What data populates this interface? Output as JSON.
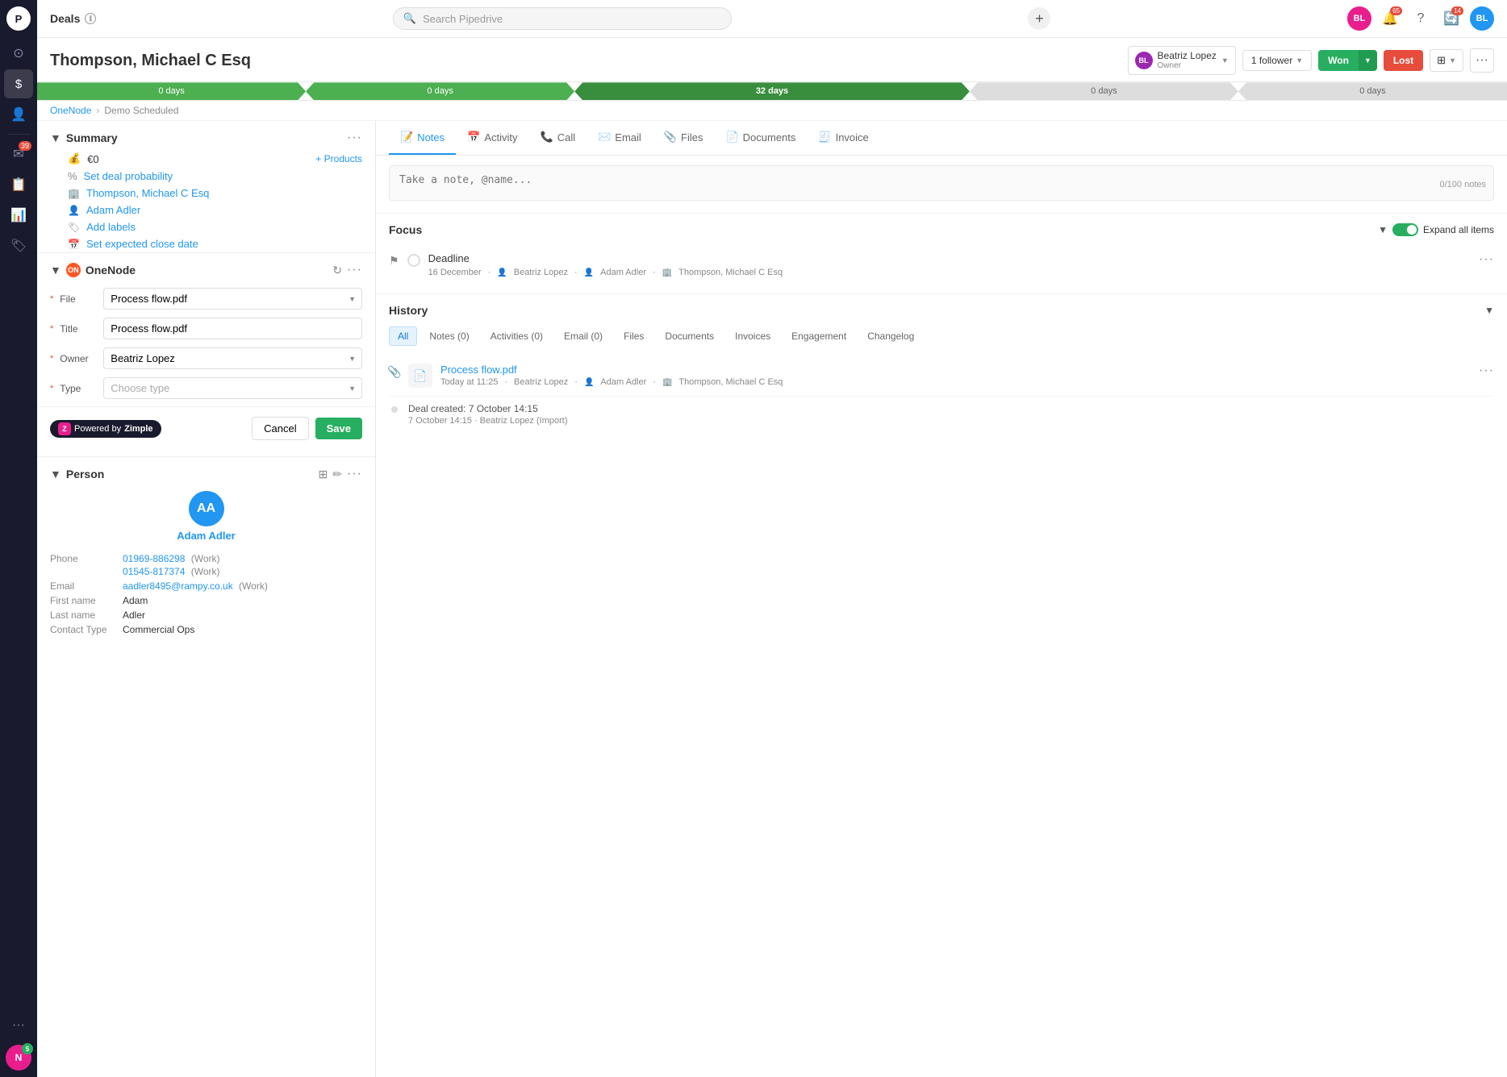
{
  "app": {
    "title": "Deals",
    "search_placeholder": "Search Pipedrive"
  },
  "deal": {
    "title": "Thompson, Michael C Esq",
    "owner": {
      "name": "Beatriz Lopez",
      "role": "Owner",
      "avatar_initials": "BL"
    },
    "follower_label": "1 follower",
    "won_label": "Won",
    "lost_label": "Lost",
    "pipeline": [
      {
        "label": "0 days",
        "active": true
      },
      {
        "label": "0 days",
        "active": true
      },
      {
        "label": "32 days",
        "active": true
      },
      {
        "label": "0 days",
        "active": false
      },
      {
        "label": "0 days",
        "active": false
      }
    ],
    "breadcrumb": {
      "org": "OneNode",
      "stage": "Demo Scheduled"
    }
  },
  "summary": {
    "section_title": "Summary",
    "amount": "€0",
    "add_products_label": "+ Products",
    "set_deal_probability": "Set deal probability",
    "contact": "Thompson, Michael C Esq",
    "person": "Adam Adler",
    "add_labels": "Add labels",
    "set_close_date": "Set expected close date"
  },
  "onenode": {
    "section_title": "OneNode",
    "file_label": "File",
    "file_value": "Process flow.pdf",
    "title_label": "Title",
    "title_value": "Process flow.pdf",
    "owner_label": "Owner",
    "owner_value": "Beatriz Lopez",
    "type_label": "Type",
    "type_placeholder": "Choose type",
    "cancel_label": "Cancel",
    "save_label": "Save",
    "powered_by": "Powered by",
    "zimple_label": "Zimple"
  },
  "person": {
    "section_title": "Person",
    "name": "Adam Adler",
    "avatar_initials": "AA",
    "phone1": "01969-886298",
    "phone1_type": "(Work)",
    "phone2": "01545-817374",
    "phone2_type": "(Work)",
    "email": "aadler8495@rampy.co.uk",
    "email_type": "(Work)",
    "first_name_label": "First name",
    "first_name": "Adam",
    "last_name_label": "Last name",
    "last_name": "Adler",
    "contact_type_label": "Contact Type",
    "contact_type": "Commercial Ops",
    "phone_label": "Phone",
    "email_label": "Email"
  },
  "tabs": [
    {
      "id": "notes",
      "label": "Notes",
      "icon": "📝",
      "active": true
    },
    {
      "id": "activity",
      "label": "Activity",
      "icon": "📅",
      "active": false
    },
    {
      "id": "call",
      "label": "Call",
      "icon": "📞",
      "active": false
    },
    {
      "id": "email",
      "label": "Email",
      "icon": "✉️",
      "active": false
    },
    {
      "id": "files",
      "label": "Files",
      "icon": "📎",
      "active": false
    },
    {
      "id": "documents",
      "label": "Documents",
      "icon": "📄",
      "active": false
    },
    {
      "id": "invoice",
      "label": "Invoice",
      "icon": "🧾",
      "active": false
    }
  ],
  "notes": {
    "placeholder": "Take a note, @name...",
    "count": "0/100 notes"
  },
  "focus": {
    "title": "Focus",
    "expand_label": "Expand all items",
    "item": {
      "name": "Deadline",
      "date": "16 December",
      "assignee": "Beatriz Lopez",
      "person": "Adam Adler",
      "org": "Thompson, Michael C Esq"
    }
  },
  "history": {
    "title": "History",
    "tabs": [
      {
        "label": "All",
        "active": true
      },
      {
        "label": "Notes (0)",
        "active": false
      },
      {
        "label": "Activities (0)",
        "active": false
      },
      {
        "label": "Email (0)",
        "active": false
      },
      {
        "label": "Files",
        "active": false
      },
      {
        "label": "Documents",
        "active": false
      },
      {
        "label": "Invoices",
        "active": false
      },
      {
        "label": "Engagement",
        "active": false
      },
      {
        "label": "Changelog",
        "active": false
      }
    ],
    "items": [
      {
        "type": "file",
        "filename": "Process flow.pdf",
        "time": "Today at 11:25",
        "owner": "Beatriz Lopez",
        "person": "Adam Adler",
        "org": "Thompson, Michael C Esq"
      }
    ],
    "created": {
      "label": "Deal created: 7 October 14:15",
      "meta": "7 October 14:15 · Beatriz Lopez (Import)"
    }
  },
  "nav": {
    "badges": {
      "notifications": "65",
      "messages": "39",
      "updates": "14"
    },
    "bottom_avatar": "5"
  }
}
